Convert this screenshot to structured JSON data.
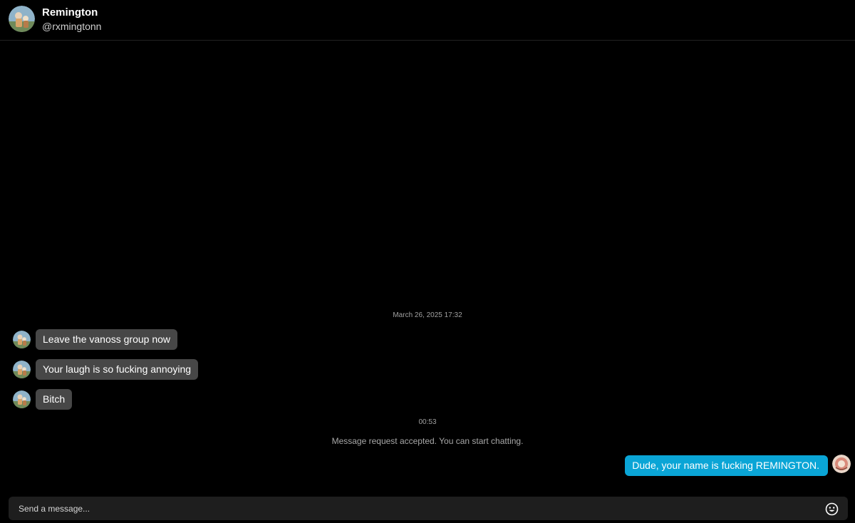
{
  "header": {
    "name": "Remington",
    "handle": "@rxmingtonn",
    "avatar_icon": "profile-avatar-icon"
  },
  "chat": {
    "date_stamp": "March 26, 2025 17:32",
    "incoming_messages": [
      {
        "text": "Leave the vanoss group now"
      },
      {
        "text": "Your laugh is so fucking annoying"
      },
      {
        "text": "Bitch"
      }
    ],
    "time_stamp": "00:53",
    "system_note": "Message request accepted. You can start chatting.",
    "outgoing_messages": [
      {
        "text": "Dude, your name is fucking REMINGTON."
      }
    ]
  },
  "composer": {
    "placeholder": "Send a message...",
    "value": "",
    "emoji_icon": "emoji-icon"
  },
  "colors": {
    "background": "#000000",
    "incoming_bubble": "#474747",
    "outgoing_bubble": "#0aa5d6",
    "composer": "#1e1e1e"
  }
}
